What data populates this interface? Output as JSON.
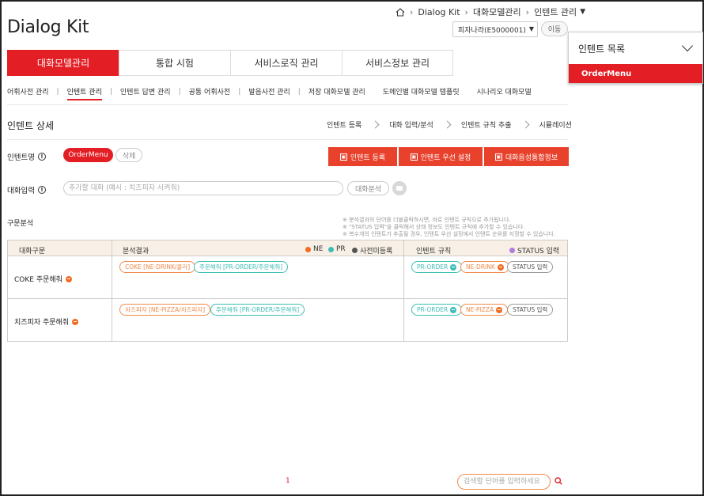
{
  "breadcrumb": [
    "Dialog Kit",
    "대화모델관리",
    "인텐트 관리"
  ],
  "app_title": "Dialog Kit",
  "project_select": "피자나라(E5000001)",
  "move_button": "이동",
  "intent_list": {
    "title": "인텐트 목록",
    "items": [
      "OrderMenu"
    ]
  },
  "main_tabs": [
    "대화모델관리",
    "통합 시험",
    "서비스로직 관리",
    "서비스정보 관리"
  ],
  "sub_nav": [
    "어휘사전 관리",
    "인텐트 관리",
    "인텐트 답변 관리",
    "공통 어휘사전",
    "발음사전 관리",
    "저장 대화모델 관리",
    "도메인별 대화모델 템플릿",
    "시나리오 대화모델"
  ],
  "section_title": "인텐트 상세",
  "steps": [
    "인텐트 등록",
    "대화 입력/분석",
    "인텐트 규칙 추출",
    "시뮬레이션"
  ],
  "intent_name_label": "인텐트명",
  "intent_name": "OrderMenu",
  "delete_button": "삭제",
  "actions": [
    "인텐트 등록",
    "인텐트 우선 설정",
    "대화음성통합정보"
  ],
  "utterance_label": "대화입력",
  "utterance_placeholder": "추가할 대화 (예시 : 치즈피자 시켜줘)",
  "analyze_button": "대화분석",
  "syntax_title": "구문분석",
  "notes": [
    "※ 분석결과의 단어를 더블클릭하시면, 바로 인텐트 규칙으로 추가됩니다.",
    "※ \"STATUS 입력\"을 클릭해서 상태 정보도 인텐트 규칙에 추가할 수 있습니다.",
    "※ 복수개의 인텐트가 추출될 경우, 인텐트 우선 설정에서 인텐트 순위를 지정할 수 있습니다."
  ],
  "table": {
    "headers": {
      "phrase": "대화구문",
      "result": "분석결과",
      "rules": "인텐트 규칙"
    },
    "legend": {
      "ne": "NE",
      "pr": "PR",
      "unreg": "사전미등록",
      "status": "STATUS 입력"
    },
    "colors": {
      "ne": "#f26b21",
      "pr": "#3dbfb5",
      "unreg": "#555555",
      "status": "#b07be0"
    },
    "rows": [
      {
        "phrase": "COKE 주문해줘",
        "results": [
          "COKE [NE-DRINK/콜라]",
          "주문해줘 [PR-ORDER/주문해줘]"
        ],
        "rules": [
          "PR-ORDER",
          "NE-DRINK",
          "STATUS 입력"
        ]
      },
      {
        "phrase": "치즈피자 주문해줘",
        "results": [
          "치즈피자 [NE-PIZZA/치즈피자]",
          "주문해줘 [PR-ORDER/주문해줘]"
        ],
        "rules": [
          "PR-ORDER",
          "NE-PIZZA",
          "STATUS 입력"
        ]
      }
    ]
  },
  "pagination": {
    "current": "1"
  },
  "search_placeholder": "검색할 단어를 입력하세요",
  "accent_color": "#e31e24"
}
